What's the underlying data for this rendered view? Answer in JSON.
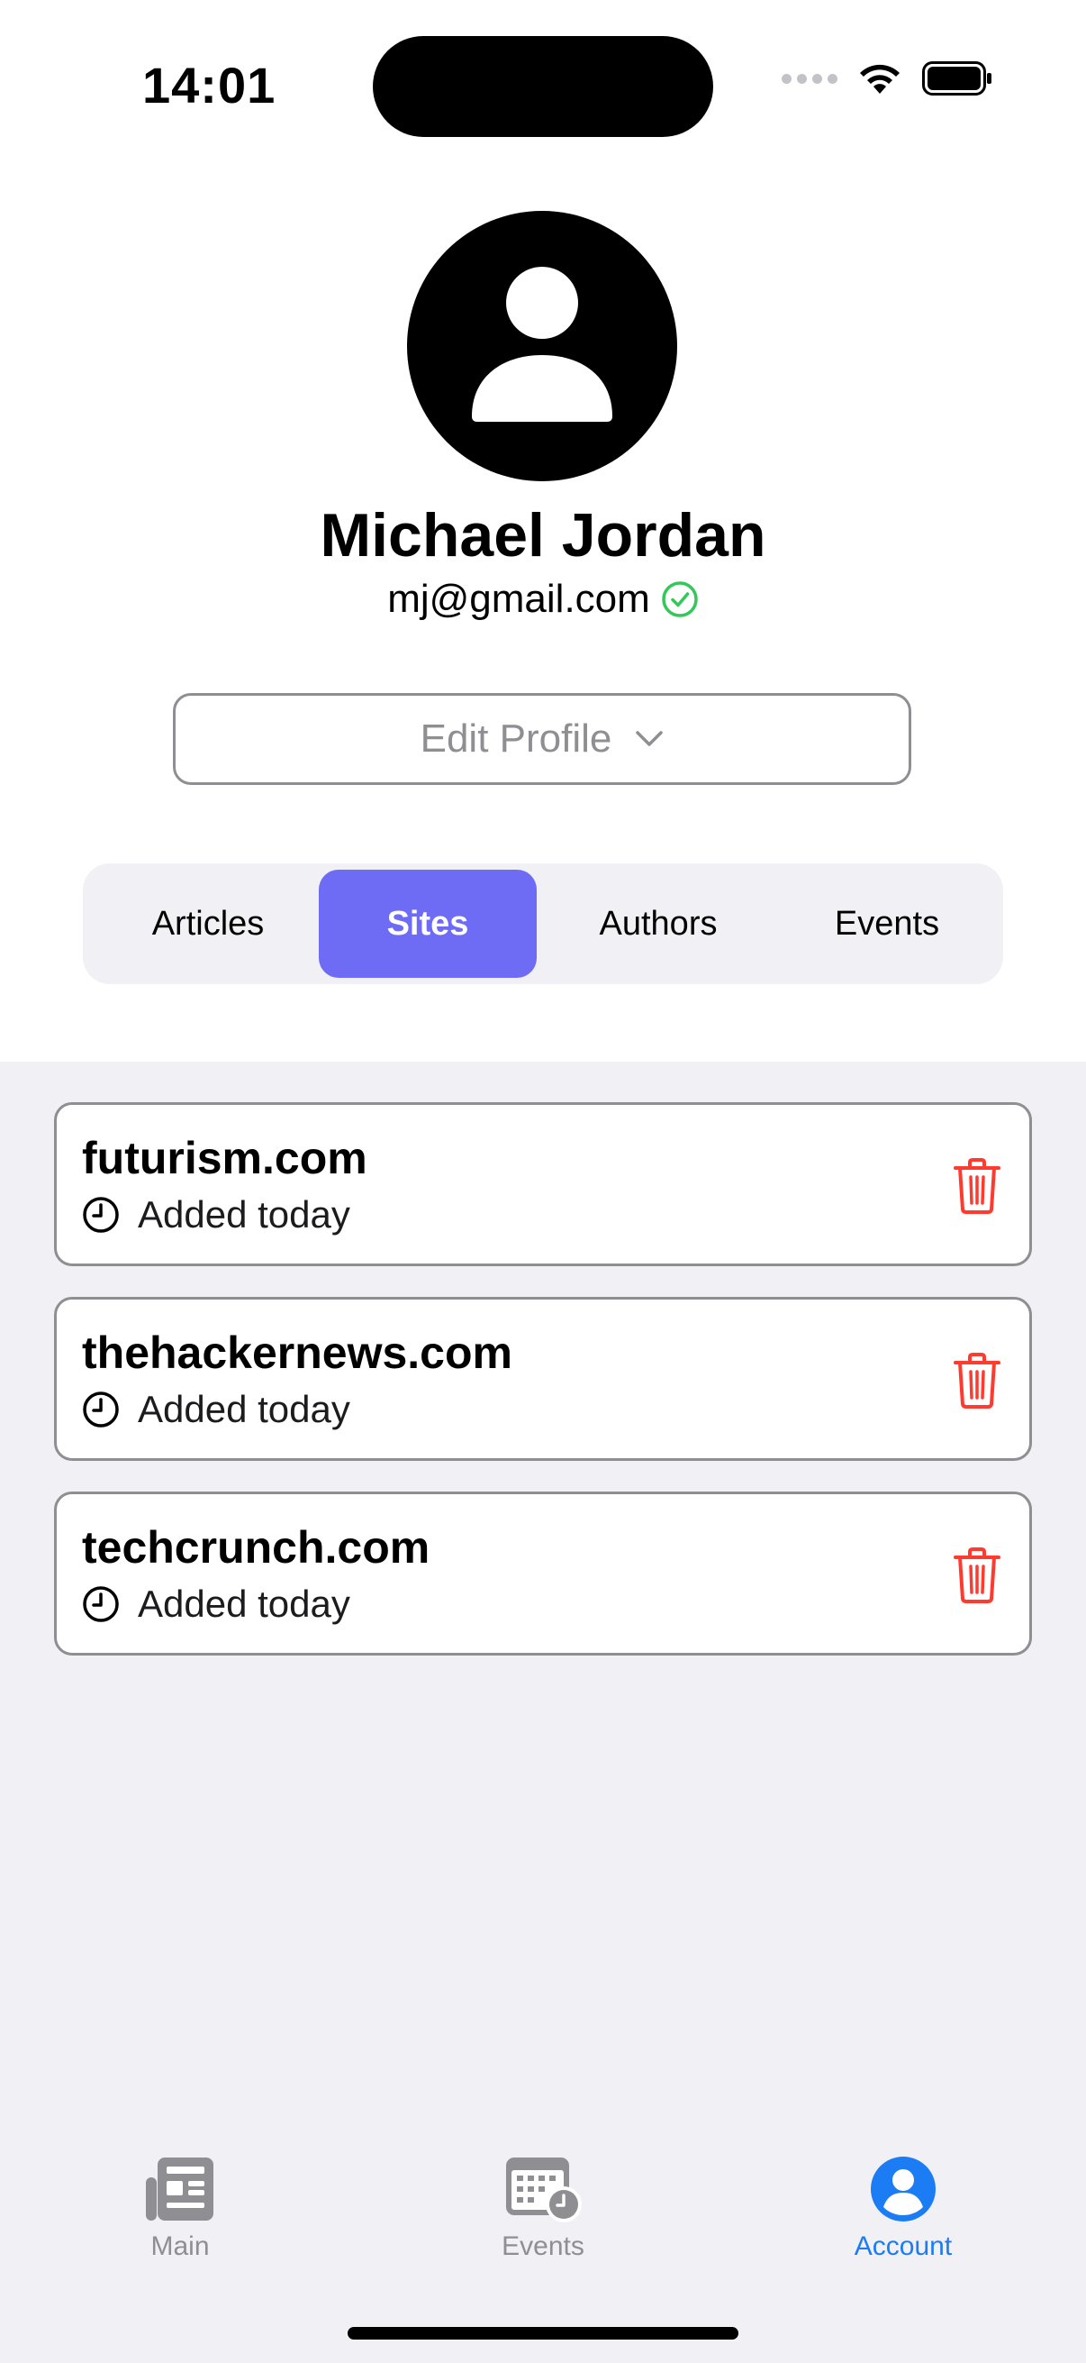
{
  "status_bar": {
    "time": "14:01"
  },
  "profile": {
    "name": "Michael Jordan",
    "email": "mj@gmail.com",
    "edit_label": "Edit Profile"
  },
  "segments": [
    {
      "label": "Articles",
      "active": false
    },
    {
      "label": "Sites",
      "active": true
    },
    {
      "label": "Authors",
      "active": false
    },
    {
      "label": "Events",
      "active": false
    }
  ],
  "sites": [
    {
      "name": "futurism.com",
      "added": "Added today"
    },
    {
      "name": "thehackernews.com",
      "added": "Added today"
    },
    {
      "name": "techcrunch.com",
      "added": "Added today"
    }
  ],
  "tab_bar": [
    {
      "label": "Main",
      "icon": "newspaper-icon",
      "active": false
    },
    {
      "label": "Events",
      "icon": "calendar-clock-icon",
      "active": false
    },
    {
      "label": "Account",
      "icon": "person-circle-icon",
      "active": true
    }
  ],
  "colors": {
    "accent": "#6e6cf5",
    "tab_active": "#1c7cf4",
    "delete": "#ff3b30",
    "verified": "#34c759"
  }
}
